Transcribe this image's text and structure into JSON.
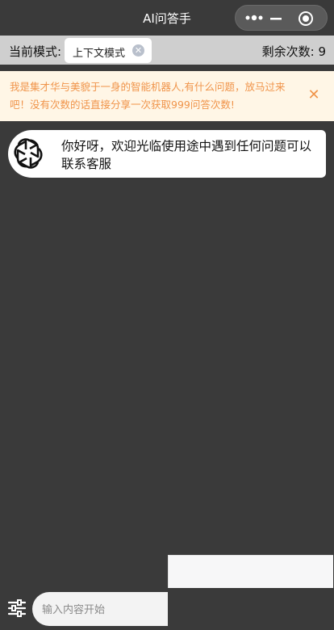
{
  "nav": {
    "title": "AI问答手"
  },
  "mode": {
    "label": "当前模式:",
    "current": "上下文模式",
    "remaining_label": "剩余次数:",
    "remaining_count": "9"
  },
  "notice": {
    "text": "我是集才华与美貌于一身的智能机器人,有什么问题，放马过来吧！没有次数的话直接分享一次获取999问答次数!",
    "close_icon": "close-icon"
  },
  "messages": [
    {
      "sender": "bot",
      "avatar_icon": "openai-logo-icon",
      "text": "你好呀，欢迎光临使用途中遇到任何问题可以联系客服"
    }
  ],
  "input": {
    "placeholder": "输入内容开始"
  },
  "colors": {
    "background": "#3a3a3a",
    "mode_bar": "#cfcfcf",
    "notice_bg": "#fff6e6",
    "notice_text": "#f0944a",
    "bubble": "#ffffff"
  }
}
